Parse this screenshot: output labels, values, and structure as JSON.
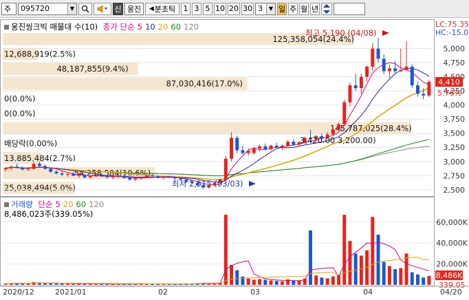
{
  "toolbar": {
    "type_label": "주",
    "code": "095720",
    "sin_label": "신",
    "name": "웅진",
    "period_label": "분초틱",
    "periods": [
      "1",
      "3",
      "5",
      "10",
      "20",
      "30"
    ],
    "count": "3",
    "units": [
      "일",
      "주",
      "월",
      "년"
    ],
    "unit_selected": "일"
  },
  "colors": {
    "up": "#e8231b",
    "down": "#1a56d6",
    "ma5": "#d60088",
    "ma10": "#1c2aa0",
    "ma20": "#e0a400",
    "ma60": "#1d8a1d",
    "ma120": "#8a8a8a",
    "band": "#f5e6cf"
  },
  "price_panel": {
    "legend_name": "웅진씽크빅 매물대 수(10)",
    "legend_ma": "종가 단순",
    "ma_periods": [
      "5",
      "10",
      "20",
      "60",
      "120"
    ],
    "high_label": "최고 5,190 (04/08)",
    "low_label": "최저 2,515 (03/03)",
    "current_price": "4,410",
    "current_pct": "5.76%",
    "lc_label": "LC:75.35",
    "hc_label": "HC:-15.0",
    "y_ticks": [
      "5,000",
      "4,750",
      "4,500",
      "4,250",
      "4,000",
      "3,750",
      "3,500",
      "3,250",
      "3,000",
      "2,750",
      "2,500"
    ]
  },
  "volume_profile": [
    {
      "label": "125,358,054(24.4%)",
      "pct": 24.4
    },
    {
      "label": "12,688,919(2.5%)",
      "pct": 2.5
    },
    {
      "label": "48,187,855(9.4%)",
      "pct": 9.4
    },
    {
      "label": "87,030,416(17.0%)",
      "pct": 17.0
    },
    {
      "label": "0(0.0%)",
      "pct": 0
    },
    {
      "label": "0(0.0%)",
      "pct": 0
    },
    {
      "label": "145,787,025(28.4%)",
      "pct": 28.4
    },
    {
      "label": "배당락(0.00%)",
      "pct": 0
    },
    {
      "label": "13,885,484(2.7%)",
      "pct": 2.7
    },
    {
      "label": "54,258,584(10.6%)",
      "pct": 10.6
    },
    {
      "label": "25,038,494(5.0%)",
      "pct": 5.0
    }
  ],
  "price_note": "3,420.00   3,200.00)",
  "volume_panel": {
    "legend_name": "거래량",
    "legend_ma": "단순",
    "ma_periods": [
      "5",
      "20",
      "60",
      "120"
    ],
    "summary": "8,486,023주(339.05%)",
    "current_vol": "8,486K",
    "current_pct": "339.05",
    "y_ticks": [
      "60,000K",
      "40,000K",
      "20,000K"
    ]
  },
  "x_axis": [
    "2020/12",
    "2021/01",
    "02",
    "03",
    "04",
    "04/20"
  ],
  "chart_data": {
    "type": "candlestick",
    "ylim": [
      2400,
      5300
    ],
    "volume_ylim": [
      0,
      75000
    ],
    "candles": [
      [
        2860,
        2900,
        2820,
        2880,
        1200
      ],
      [
        2880,
        2930,
        2850,
        2910,
        1500
      ],
      [
        2910,
        2960,
        2880,
        2890,
        1800
      ],
      [
        2890,
        2920,
        2840,
        2860,
        1300
      ],
      [
        2860,
        2900,
        2830,
        2870,
        1100
      ],
      [
        2870,
        2990,
        2860,
        2960,
        2600
      ],
      [
        2960,
        3000,
        2900,
        2920,
        2200
      ],
      [
        2920,
        2950,
        2860,
        2870,
        1600
      ],
      [
        2870,
        2890,
        2800,
        2820,
        1400
      ],
      [
        2820,
        2850,
        2770,
        2790,
        1200
      ],
      [
        2790,
        2820,
        2740,
        2770,
        1100
      ],
      [
        2770,
        2800,
        2730,
        2780,
        1000
      ],
      [
        2780,
        2810,
        2740,
        2750,
        900
      ],
      [
        2750,
        2790,
        2710,
        2760,
        1000
      ],
      [
        2760,
        2780,
        2700,
        2720,
        1100
      ],
      [
        2720,
        2760,
        2690,
        2740,
        900
      ],
      [
        2740,
        2780,
        2720,
        2760,
        800
      ],
      [
        2760,
        2790,
        2730,
        2740,
        900
      ],
      [
        2740,
        2760,
        2700,
        2720,
        800
      ],
      [
        2720,
        2750,
        2690,
        2730,
        700
      ],
      [
        2730,
        2760,
        2710,
        2740,
        800
      ],
      [
        2740,
        2770,
        2700,
        2710,
        900
      ],
      [
        2710,
        2740,
        2660,
        2680,
        1200
      ],
      [
        2680,
        2720,
        2650,
        2700,
        900
      ],
      [
        2700,
        2730,
        2680,
        2720,
        800
      ],
      [
        2720,
        2760,
        2700,
        2750,
        1000
      ],
      [
        2750,
        2790,
        2730,
        2740,
        1100
      ],
      [
        2740,
        2760,
        2700,
        2710,
        900
      ],
      [
        2710,
        2740,
        2680,
        2730,
        800
      ],
      [
        2730,
        2750,
        2700,
        2720,
        700
      ],
      [
        2720,
        2740,
        2680,
        2700,
        800
      ],
      [
        2700,
        2720,
        2660,
        2680,
        900
      ],
      [
        2680,
        2700,
        2620,
        2640,
        1200
      ],
      [
        2640,
        2670,
        2600,
        2620,
        1300
      ],
      [
        2620,
        2650,
        2560,
        2580,
        1500
      ],
      [
        2580,
        2600,
        2515,
        2540,
        1800
      ],
      [
        2540,
        2600,
        2520,
        2580,
        1400
      ],
      [
        2580,
        2640,
        2560,
        2620,
        1300
      ],
      [
        2620,
        2700,
        2600,
        2680,
        2000
      ],
      [
        2680,
        3100,
        2670,
        3050,
        67000
      ],
      [
        3050,
        3520,
        3000,
        3420,
        19000
      ],
      [
        3420,
        3460,
        3150,
        3200,
        14000
      ],
      [
        3200,
        3280,
        3120,
        3150,
        8000
      ],
      [
        3150,
        3230,
        3100,
        3190,
        6000
      ],
      [
        3150,
        3260,
        3120,
        3230,
        5000
      ],
      [
        3230,
        3300,
        3180,
        3270,
        5500
      ],
      [
        3270,
        3320,
        3200,
        3220,
        4800
      ],
      [
        3220,
        3300,
        3190,
        3280,
        4200
      ],
      [
        3280,
        3330,
        3240,
        3250,
        3800
      ],
      [
        3250,
        3300,
        3200,
        3280,
        3500
      ],
      [
        3280,
        3380,
        3260,
        3350,
        5200
      ],
      [
        3350,
        3400,
        3280,
        3300,
        4100
      ],
      [
        3300,
        3360,
        3270,
        3340,
        3900
      ],
      [
        3340,
        3440,
        3320,
        3420,
        6100
      ],
      [
        3420,
        3560,
        3380,
        3400,
        52000
      ],
      [
        3400,
        3470,
        3350,
        3450,
        9000
      ],
      [
        3450,
        3500,
        3380,
        3420,
        7000
      ],
      [
        3420,
        3520,
        3400,
        3480,
        6200
      ],
      [
        3480,
        3600,
        3450,
        3570,
        8100
      ],
      [
        3570,
        3700,
        3540,
        3660,
        9500
      ],
      [
        3660,
        4100,
        3640,
        4050,
        67000
      ],
      [
        4050,
        4400,
        3980,
        4350,
        42000
      ],
      [
        4350,
        4550,
        4250,
        4300,
        30000
      ],
      [
        4300,
        4560,
        4200,
        4500,
        28000
      ],
      [
        4500,
        4700,
        4420,
        4680,
        33000
      ],
      [
        4680,
        5100,
        4600,
        5000,
        65000
      ],
      [
        5000,
        5190,
        4750,
        4820,
        48000
      ],
      [
        4820,
        4900,
        4550,
        4600,
        22000
      ],
      [
        4600,
        4720,
        4480,
        4650,
        18000
      ],
      [
        4650,
        4780,
        4560,
        4600,
        15000
      ],
      [
        4600,
        5000,
        4580,
        4620,
        16000
      ],
      [
        4620,
        5130,
        4600,
        4680,
        30000
      ],
      [
        4680,
        4720,
        4300,
        4350,
        12000
      ],
      [
        4350,
        4420,
        4150,
        4200,
        10000
      ],
      [
        4200,
        4300,
        4100,
        4170,
        7000
      ],
      [
        4170,
        4450,
        4140,
        4410,
        8486
      ]
    ]
  }
}
